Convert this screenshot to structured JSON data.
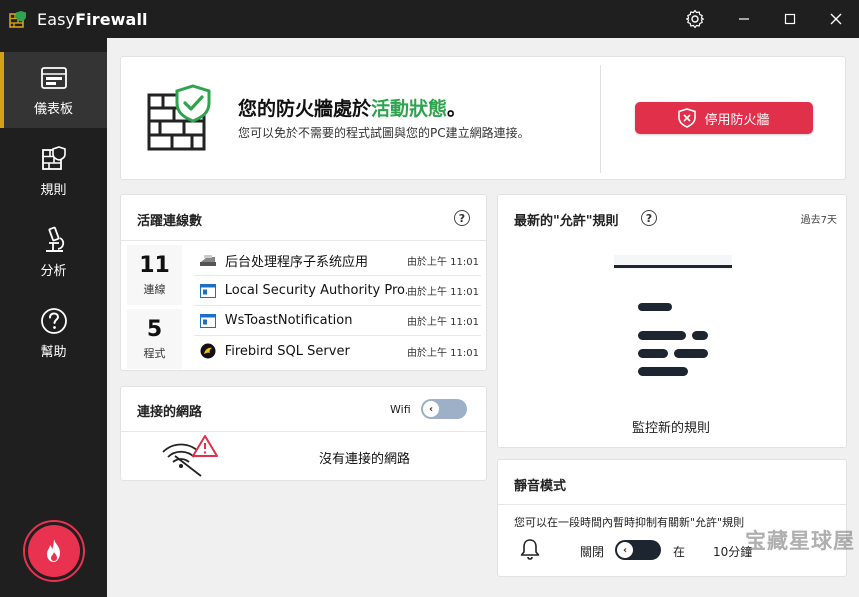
{
  "app": {
    "title_prefix": "Easy",
    "title_bold": "Firewall"
  },
  "window_controls": [
    "settings-icon",
    "minimize-icon",
    "maximize-icon",
    "close-icon"
  ],
  "sidebar": {
    "items": [
      {
        "label": "儀表板",
        "icon": "dashboard-icon",
        "active": true
      },
      {
        "label": "規則",
        "icon": "rules-firewall-icon",
        "active": false
      },
      {
        "label": "分析",
        "icon": "microscope-icon",
        "active": false
      },
      {
        "label": "幫助",
        "icon": "help-icon",
        "active": false
      }
    ],
    "panic_icon": "flame-icon"
  },
  "status": {
    "heading_prefix": "您的防火牆處於",
    "heading_state": "活動狀態",
    "heading_suffix": "。",
    "subtext": "您可以免於不需要的程式試圖與您的PC建立網路連接。",
    "stop_button": "停用防火牆",
    "colors": {
      "active_green": "#2ea44f",
      "stop_red": "#e0304a"
    }
  },
  "connections": {
    "title": "活躍連線數",
    "help": "?",
    "stats": [
      {
        "value": "11",
        "label": "連線"
      },
      {
        "value": "5",
        "label": "程式"
      }
    ],
    "rows": [
      {
        "name": "后台处理程序子系统应用",
        "time": "由於上午 11:01",
        "icon": "printer-icon"
      },
      {
        "name": "Local Security Authority Pro...",
        "time": "由於上午 11:01",
        "icon": "window-app-icon"
      },
      {
        "name": "WsToastNotification",
        "time": "由於上午 11:01",
        "icon": "window-app-icon"
      },
      {
        "name": "Firebird SQL Server",
        "time": "由於上午 11:01",
        "icon": "firebird-icon"
      }
    ]
  },
  "network": {
    "title": "連接的網路",
    "wifi_label": "Wifi",
    "wifi_on": false,
    "no_network": "沒有連接的網路",
    "icon": "wifi-warning-icon"
  },
  "latest_rules": {
    "title": "最新的\"允許\"規則",
    "help": "?",
    "period": "過去7天",
    "monitor_label": "監控新的規則"
  },
  "silent_mode": {
    "title": "靜音模式",
    "description": "您可以在一段時間內暫時抑制有關新\"允許\"規則",
    "off_label": "關閉",
    "enabled": false,
    "at_label": "在",
    "duration": "10分鐘"
  },
  "watermark": "宝藏星球屋"
}
